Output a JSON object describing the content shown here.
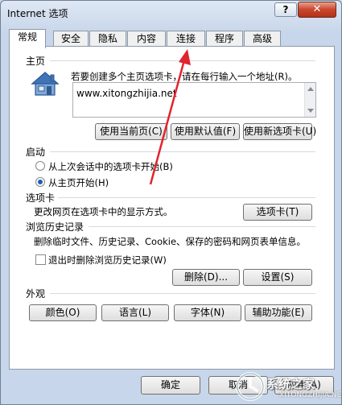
{
  "window": {
    "title": "Internet 选项",
    "help_label": "?",
    "close_label": "✕"
  },
  "tabs": [
    {
      "label": "常规",
      "active": true
    },
    {
      "label": "安全"
    },
    {
      "label": "隐私"
    },
    {
      "label": "内容"
    },
    {
      "label": "连接"
    },
    {
      "label": "程序"
    },
    {
      "label": "高级"
    }
  ],
  "home": {
    "section": "主页",
    "description": "若要创建多个主页选项卡，请在每行输入一个地址(R)。",
    "url": "www.xitongzhijia.net",
    "btn_current": "使用当前页(C)",
    "btn_default": "使用默认值(F)",
    "btn_newtab": "使用新选项卡(U)",
    "icon": "home-icon"
  },
  "startup": {
    "section": "启动",
    "option_last": "从上次会话中的选项卡开始(B)",
    "option_home": "从主页开始(H)",
    "selected": "option_home"
  },
  "tabs_section": {
    "section": "选项卡",
    "description": "更改网页在选项卡中的显示方式。",
    "btn": "选项卡(T)"
  },
  "history": {
    "section": "浏览历史记录",
    "description": "删除临时文件、历史记录、Cookie、保存的密码和网页表单信息。",
    "checkbox": "退出时删除浏览历史记录(W)",
    "checked": false,
    "btn_delete": "删除(D)...",
    "btn_settings": "设置(S)"
  },
  "appearance": {
    "section": "外观",
    "btn_colors": "颜色(O)",
    "btn_languages": "语言(L)",
    "btn_fonts": "字体(N)",
    "btn_accessibility": "辅助功能(E)"
  },
  "footer": {
    "ok": "确定",
    "cancel": "取消",
    "apply": "应用(A)"
  },
  "watermark": {
    "text": "系统之家",
    "sub": "XITONGZHIJIA.NET"
  },
  "colors": {
    "accent_arrow": "#e0252f",
    "close_red": "#c9452c"
  }
}
